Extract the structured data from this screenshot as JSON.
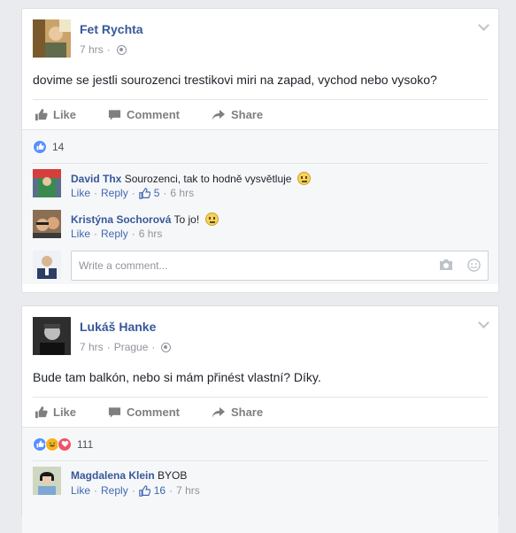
{
  "posts": [
    {
      "author": "Fet Rychta",
      "time": "7 hrs",
      "location": "",
      "text": "dovime se jestli sourozenci trestikovi miri na zapad, vychod nebo vysoko?",
      "actions": {
        "like": "Like",
        "comment": "Comment",
        "share": "Share"
      },
      "reaction_count": "14",
      "comments": [
        {
          "author": "David Thx",
          "text": "Sourozenci, tak to hodně vysvětluje",
          "like": "Like",
          "reply": "Reply",
          "likes": "5",
          "time": "6 hrs"
        },
        {
          "author": "Kristýna Sochorová",
          "text": "To jo!",
          "like": "Like",
          "reply": "Reply",
          "likes": "",
          "time": "6 hrs"
        }
      ],
      "write_placeholder": "Write a comment..."
    },
    {
      "author": "Lukáš Hanke",
      "time": "7 hrs",
      "location": "Prague",
      "text": "Bude tam balkón, nebo si mám přinést vlastní? Díky.",
      "actions": {
        "like": "Like",
        "comment": "Comment",
        "share": "Share"
      },
      "reaction_count": "111",
      "comments": [
        {
          "author": "Magdalena Klein",
          "text": "BYOB",
          "like": "Like",
          "reply": "Reply",
          "likes": "16",
          "time": "7 hrs"
        }
      ]
    }
  ],
  "colors": {
    "link": "#365899",
    "like_blue": "#5890ff",
    "meta_gray": "#90949c",
    "background": "#e9ebee"
  },
  "separator": "·"
}
